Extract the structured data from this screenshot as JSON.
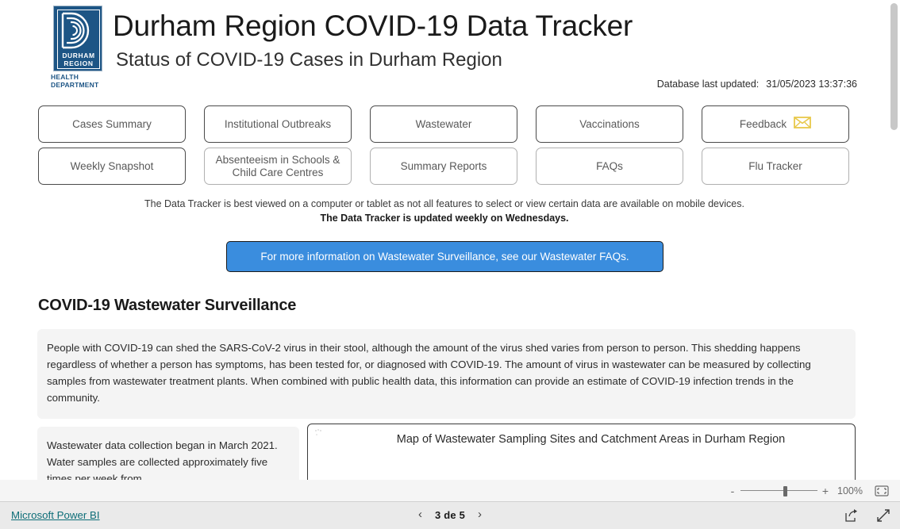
{
  "header": {
    "logo": {
      "name_line1": "DURHAM",
      "name_line2": "REGION",
      "dept_line1": "HEALTH",
      "dept_line2": "DEPARTMENT",
      "color": "#1d5585"
    },
    "title": "Durham Region COVID-19 Data Tracker",
    "subtitle": "Status of COVID-19 Cases in Durham Region",
    "updated_label": "Database last updated:",
    "updated_value": "31/05/2023 13:37:36"
  },
  "nav": {
    "row1": [
      {
        "label": "Cases Summary",
        "style": "dark",
        "icon": ""
      },
      {
        "label": "Institutional Outbreaks",
        "style": "dark",
        "icon": ""
      },
      {
        "label": "Wastewater",
        "style": "dark",
        "icon": ""
      },
      {
        "label": "Vaccinations",
        "style": "dark",
        "icon": ""
      },
      {
        "label": "Feedback",
        "style": "dark",
        "icon": "envelope-icon"
      }
    ],
    "row2": [
      {
        "label": "Weekly Snapshot",
        "style": "dark",
        "icon": ""
      },
      {
        "label": "Absenteeism in Schools & Child Care Centres",
        "style": "light",
        "icon": ""
      },
      {
        "label": "Summary Reports",
        "style": "light",
        "icon": ""
      },
      {
        "label": "FAQs",
        "style": "light",
        "icon": ""
      },
      {
        "label": "Flu Tracker",
        "style": "light",
        "icon": ""
      }
    ]
  },
  "notes": {
    "line1": "The Data Tracker is best viewed on a computer or tablet as not all features to select or view certain data are available on mobile devices.",
    "line2": "The Data Tracker is updated weekly on Wednesdays."
  },
  "cta": {
    "label": "For more information on Wastewater Surveillance, see our Wastewater FAQs.",
    "bg_color": "#3a8dde"
  },
  "section": {
    "heading": "COVID-19 Wastewater Surveillance",
    "paragraph": "People with COVID-19 can shed the SARS-CoV-2 virus in their stool, although the amount of the virus shed varies from person to person. This shedding happens regardless of whether a person has symptoms, has been tested for, or diagnosed with COVID-19. The amount of virus in wastewater can be measured by collecting samples from wastewater treatment plants. When combined with public health data, this information can provide an estimate of COVID-19 infection trends in the community."
  },
  "bottom": {
    "left_card_text": "Wastewater data collection began in March 2021. Water samples are collected approximately five times per week from",
    "map_title": "Map of Wastewater Sampling Sites and Catchment Areas in Durham Region"
  },
  "zoombar": {
    "minus": "-",
    "plus": "+",
    "percent": "100%",
    "fit_icon": "fit-to-page-icon"
  },
  "statusbar": {
    "powerbi_link": "Microsoft Power BI",
    "prev_icon": "chevron-left-icon",
    "next_icon": "chevron-right-icon",
    "page_label": "3 de 5",
    "share_icon": "share-icon",
    "fullscreen_icon": "fullscreen-icon"
  }
}
